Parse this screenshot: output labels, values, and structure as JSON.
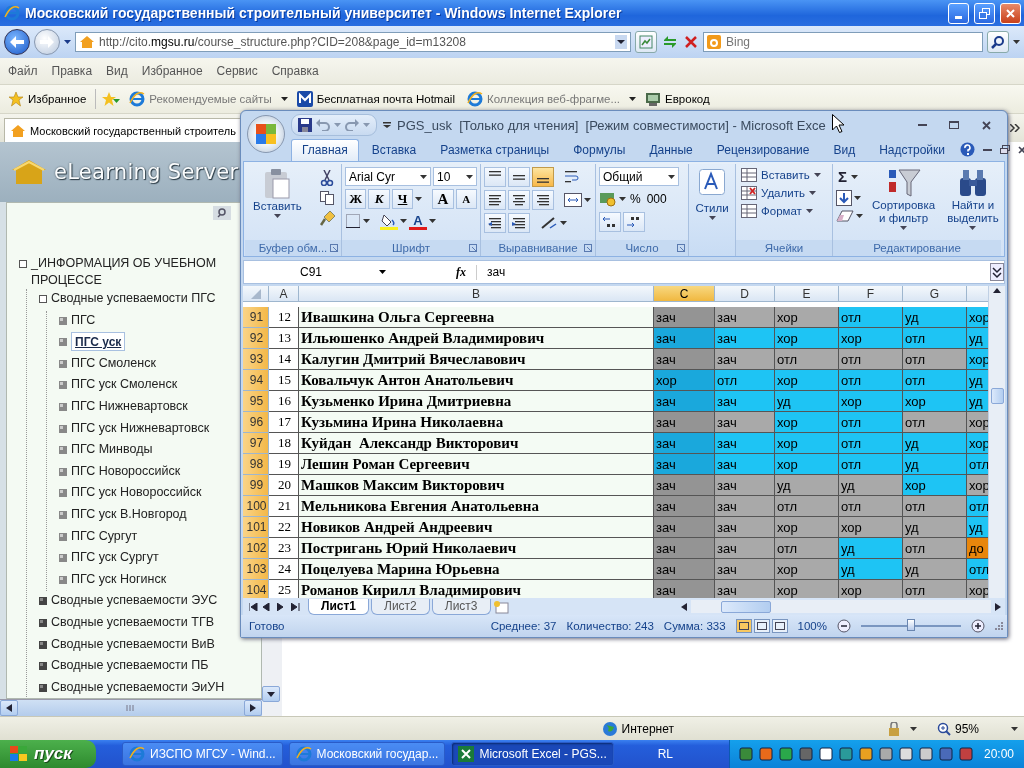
{
  "browser": {
    "title": "Московский государственный строительный университет - Windows Internet Explorer",
    "address": "http://cito.**mgsu.ru**/course_structure.php?CID=208&page_id=m13208",
    "search": {
      "placeholder": "Bing"
    },
    "menu": [
      "Файл",
      "Правка",
      "Вид",
      "Избранное",
      "Сервис",
      "Справка"
    ],
    "favorites_label": "Избранное",
    "favorites": [
      {
        "label": "Рекомендуемые сайты",
        "kind": "ie",
        "dropdown": true
      },
      {
        "label": "Бесплатная почта Hotmail",
        "kind": "mail",
        "dropdown": false
      },
      {
        "label": "Коллекция веб-фрагме...",
        "kind": "ie",
        "dropdown": true
      },
      {
        "label": "Еврокод",
        "kind": "site",
        "dropdown": false
      }
    ],
    "tab": "Московский государственный строитель",
    "status": "Интернет",
    "zoom": "95%"
  },
  "sidebar": {
    "logo": "eLearning Server",
    "tree": [
      {
        "label": "_ИНФОРМАЦИЯ ОБ УЧЕБНОМ ПРОЦЕССЕ",
        "expanded": true,
        "children": [
          {
            "label": "Сводные успеваемости ПГС",
            "expanded": true,
            "children": [
              {
                "label": "ПГС",
                "selected": false
              },
              {
                "label": "ПГС уск",
                "selected": true
              },
              {
                "label": "ПГС Смоленск",
                "selected": false
              },
              {
                "label": "ПГС уск Смоленск",
                "selected": false
              },
              {
                "label": "ПГС Нижневартовск",
                "selected": false
              },
              {
                "label": "ПГС уск Нижневартовск",
                "selected": false
              },
              {
                "label": "ПГС Минводы",
                "selected": false
              },
              {
                "label": "ПГС Новороссийск",
                "selected": false
              },
              {
                "label": "ПГС уск Новороссийск",
                "selected": false
              },
              {
                "label": "ПГС уск В.Новгород",
                "selected": false
              },
              {
                "label": "ПГС Сургут",
                "selected": false
              },
              {
                "label": "ПГС уск Сургут",
                "selected": false
              },
              {
                "label": "ПГС уск Ногинск",
                "selected": false
              }
            ]
          },
          {
            "label": "Сводные успеваемости ЭУС",
            "expanded": false
          },
          {
            "label": "Сводные успеваемости ТГВ",
            "expanded": false
          },
          {
            "label": "Сводные успеваемости ВиВ",
            "expanded": false
          },
          {
            "label": "Сводные успеваемости ПБ",
            "expanded": false
          },
          {
            "label": "Сводные успеваемости ЭиУН",
            "expanded": false
          }
        ]
      }
    ]
  },
  "excel": {
    "title": "PGS_usk  [Только для чтения]  [Режим совместимости] - Microsoft Exce",
    "ribbon_tabs": [
      {
        "label": "Главная",
        "selected": true
      },
      {
        "label": "Вставка",
        "selected": false
      },
      {
        "label": "Разметка страницы",
        "selected": false
      },
      {
        "label": "Формулы",
        "selected": false
      },
      {
        "label": "Данные",
        "selected": false
      },
      {
        "label": "Рецензирование",
        "selected": false
      },
      {
        "label": "Вид",
        "selected": false
      },
      {
        "label": "Надстройки",
        "selected": false
      }
    ],
    "clipboard": {
      "paste": "Вставить",
      "group": "Буфер обм..."
    },
    "font": {
      "name": "Arial Cyr",
      "size": "10",
      "styles": [
        "Ж",
        "К",
        "Ч"
      ],
      "size_buttons": [
        "A",
        "A"
      ],
      "color_button": "A",
      "group": "Шрифт"
    },
    "alignment": {
      "vertical": [
        {
          "selected": false
        },
        {
          "selected": false
        },
        {
          "selected": true
        }
      ],
      "group": "Выравнивание"
    },
    "number": {
      "format": "Общий",
      "buttons": [
        "%",
        "000"
      ],
      "group": "Число"
    },
    "styles": {
      "label": "Стили"
    },
    "cells": {
      "buttons": [
        "Вставить",
        "Удалить",
        "Формат"
      ],
      "group": "Ячейки"
    },
    "editing": {
      "autosum": "Σ",
      "sort": "Сортировка и фильтр",
      "find": "Найти и выделить",
      "group": "Редактирование"
    },
    "name_box": "C91",
    "fx": "fx",
    "formula": "зач",
    "columns": [
      {
        "label": "A",
        "selected": false
      },
      {
        "label": "B",
        "selected": false
      },
      {
        "label": "C",
        "selected": true
      },
      {
        "label": "D",
        "selected": false
      },
      {
        "label": "E",
        "selected": false
      },
      {
        "label": "F",
        "selected": false
      },
      {
        "label": "G",
        "selected": false
      }
    ],
    "rows": [
      {
        "row": "91",
        "selected": true,
        "number": "12",
        "name": "Ивашкина Ольга Сергеевна",
        "cells": [
          {
            "text": "зач",
            "color": "#949494"
          },
          {
            "text": "зач",
            "color": "#a9a9a9"
          },
          {
            "text": "хор",
            "color": "#a9a9a9"
          },
          {
            "text": "отл",
            "color": "#1ec4f4"
          },
          {
            "text": "уд",
            "color": "#1ec4f4"
          },
          {
            "text": "хор",
            "color": "#1ec4f4"
          }
        ]
      },
      {
        "row": "92",
        "selected": true,
        "number": "13",
        "name": "Ильюшенко Андрей Владимирович",
        "cells": [
          {
            "text": "зач",
            "color": "#1aa8dc"
          },
          {
            "text": "зач",
            "color": "#1ec4f4"
          },
          {
            "text": "хор",
            "color": "#1ec4f4"
          },
          {
            "text": "хор",
            "color": "#1ec4f4"
          },
          {
            "text": "отл",
            "color": "#1ec4f4"
          },
          {
            "text": "уд",
            "color": "#1ec4f4"
          }
        ]
      },
      {
        "row": "93",
        "selected": true,
        "number": "14",
        "name": "Калугин Дмитрий Вячеславович",
        "cells": [
          {
            "text": "зач",
            "color": "#949494"
          },
          {
            "text": "зач",
            "color": "#a9a9a9"
          },
          {
            "text": "отл",
            "color": "#a9a9a9"
          },
          {
            "text": "отл",
            "color": "#a9a9a9"
          },
          {
            "text": "отл",
            "color": "#a9a9a9"
          },
          {
            "text": "хор",
            "color": "#1ec4f4"
          }
        ]
      },
      {
        "row": "94",
        "selected": true,
        "number": "15",
        "name": "Ковальчук Антон Анатольевич",
        "cells": [
          {
            "text": "хор",
            "color": "#1aa8dc"
          },
          {
            "text": "отл",
            "color": "#1ec4f4"
          },
          {
            "text": "хор",
            "color": "#1ec4f4"
          },
          {
            "text": "отл",
            "color": "#1ec4f4"
          },
          {
            "text": "отл",
            "color": "#1ec4f4"
          },
          {
            "text": "уд",
            "color": "#1ec4f4"
          }
        ]
      },
      {
        "row": "95",
        "selected": true,
        "number": "16",
        "name": "Кузьменко Ирина Дмитриевна",
        "cells": [
          {
            "text": "зач",
            "color": "#1aa8dc"
          },
          {
            "text": "зач",
            "color": "#1ec4f4"
          },
          {
            "text": "уд",
            "color": "#1ec4f4"
          },
          {
            "text": "хор",
            "color": "#1ec4f4"
          },
          {
            "text": "хор",
            "color": "#1ec4f4"
          },
          {
            "text": "уд",
            "color": "#1ec4f4"
          }
        ]
      },
      {
        "row": "96",
        "selected": true,
        "number": "17",
        "name": "Кузьмина Ирина Николаевна",
        "cells": [
          {
            "text": "зач",
            "color": "#949494"
          },
          {
            "text": "зач",
            "color": "#a9a9a9"
          },
          {
            "text": "хор",
            "color": "#1ec4f4"
          },
          {
            "text": "отл",
            "color": "#1ec4f4"
          },
          {
            "text": "отл",
            "color": "#a9a9a9"
          },
          {
            "text": "хор",
            "color": "#a9a9a9"
          }
        ]
      },
      {
        "row": "97",
        "selected": true,
        "number": "18",
        "name": "Куйдан  Александр Викторович",
        "cells": [
          {
            "text": "зач",
            "color": "#1aa8dc"
          },
          {
            "text": "зач",
            "color": "#1ec4f4"
          },
          {
            "text": "хор",
            "color": "#1ec4f4"
          },
          {
            "text": "отл",
            "color": "#1ec4f4"
          },
          {
            "text": "уд",
            "color": "#1ec4f4"
          },
          {
            "text": "хор",
            "color": "#1ec4f4"
          }
        ]
      },
      {
        "row": "98",
        "selected": true,
        "number": "19",
        "name": "Лешин Роман Сергеевич",
        "cells": [
          {
            "text": "зач",
            "color": "#1aa8dc"
          },
          {
            "text": "зач",
            "color": "#1ec4f4"
          },
          {
            "text": "хор",
            "color": "#1ec4f4"
          },
          {
            "text": "отл",
            "color": "#1ec4f4"
          },
          {
            "text": "уд",
            "color": "#1ec4f4"
          },
          {
            "text": "отл",
            "color": "#1ec4f4"
          }
        ]
      },
      {
        "row": "99",
        "selected": true,
        "number": "20",
        "name": "Машков Максим Викторович",
        "cells": [
          {
            "text": "зач",
            "color": "#949494"
          },
          {
            "text": "зач",
            "color": "#a9a9a9"
          },
          {
            "text": "уд",
            "color": "#a9a9a9"
          },
          {
            "text": "уд",
            "color": "#a9a9a9"
          },
          {
            "text": "хор",
            "color": "#1ec4f4"
          },
          {
            "text": "хор",
            "color": "#a9a9a9"
          }
        ]
      },
      {
        "row": "100",
        "selected": true,
        "number": "21",
        "name": "Мельникова Евгения Анатольевна",
        "cells": [
          {
            "text": "зач",
            "color": "#949494"
          },
          {
            "text": "зач",
            "color": "#a9a9a9"
          },
          {
            "text": "отл",
            "color": "#a9a9a9"
          },
          {
            "text": "отл",
            "color": "#a9a9a9"
          },
          {
            "text": "отл",
            "color": "#a9a9a9"
          },
          {
            "text": "отл",
            "color": "#1ec4f4"
          }
        ]
      },
      {
        "row": "101",
        "selected": true,
        "number": "22",
        "name": "Новиков Андрей Андреевич",
        "cells": [
          {
            "text": "зач",
            "color": "#949494"
          },
          {
            "text": "зач",
            "color": "#a9a9a9"
          },
          {
            "text": "хор",
            "color": "#a9a9a9"
          },
          {
            "text": "хор",
            "color": "#a9a9a9"
          },
          {
            "text": "уд",
            "color": "#a9a9a9"
          },
          {
            "text": "уд",
            "color": "#1ec4f4"
          }
        ]
      },
      {
        "row": "102",
        "selected": true,
        "number": "23",
        "name": "Постригань Юрий Николаевич",
        "cells": [
          {
            "text": "зач",
            "color": "#949494"
          },
          {
            "text": "зач",
            "color": "#a9a9a9"
          },
          {
            "text": "отл",
            "color": "#a9a9a9"
          },
          {
            "text": "уд",
            "color": "#1ec4f4"
          },
          {
            "text": "отл",
            "color": "#a9a9a9"
          },
          {
            "text": "до",
            "color": "#e8860c"
          }
        ]
      },
      {
        "row": "103",
        "selected": true,
        "number": "24",
        "name": "Поцелуева Марина Юрьевна",
        "cells": [
          {
            "text": "зач",
            "color": "#949494"
          },
          {
            "text": "зач",
            "color": "#a9a9a9"
          },
          {
            "text": "хор",
            "color": "#a9a9a9"
          },
          {
            "text": "уд",
            "color": "#1ec4f4"
          },
          {
            "text": "уд",
            "color": "#a9a9a9"
          },
          {
            "text": "отл",
            "color": "#1ec4f4"
          }
        ]
      },
      {
        "row": "104",
        "selected": true,
        "number": "25",
        "name": "Романов Кирилл Владимирович",
        "cells": [
          {
            "text": "зач",
            "color": "#949494"
          },
          {
            "text": "зач",
            "color": "#a9a9a9"
          },
          {
            "text": "хор",
            "color": "#a9a9a9"
          },
          {
            "text": "хор",
            "color": "#a9a9a9"
          },
          {
            "text": "отл",
            "color": "#a9a9a9"
          },
          {
            "text": "хор",
            "color": "#a9a9a9"
          }
        ]
      }
    ],
    "sheets": [
      {
        "label": "Лист1",
        "selected": true
      },
      {
        "label": "Лист2",
        "selected": false
      },
      {
        "label": "Лист3",
        "selected": false
      }
    ],
    "status": {
      "ready": "Готово",
      "stats": [
        "Среднее: 37",
        "Количество: 243",
        "Сумма: 333"
      ],
      "views": [
        {
          "selected": true
        },
        {
          "selected": false
        },
        {
          "selected": false
        }
      ],
      "zoom": {
        "label": "100%",
        "level": 0.5
      }
    }
  },
  "taskbar": {
    "start": "пуск",
    "tasks": [
      {
        "label": "ИЗСПО МГСУ - Wind...",
        "kind": "ie",
        "selected": false
      },
      {
        "label": "Московский государ...",
        "kind": "ie",
        "selected": false
      },
      {
        "label": "Microsoft Excel - PGS...",
        "kind": "excel",
        "selected": true
      }
    ],
    "lang": "RL",
    "clock": "20:00"
  }
}
